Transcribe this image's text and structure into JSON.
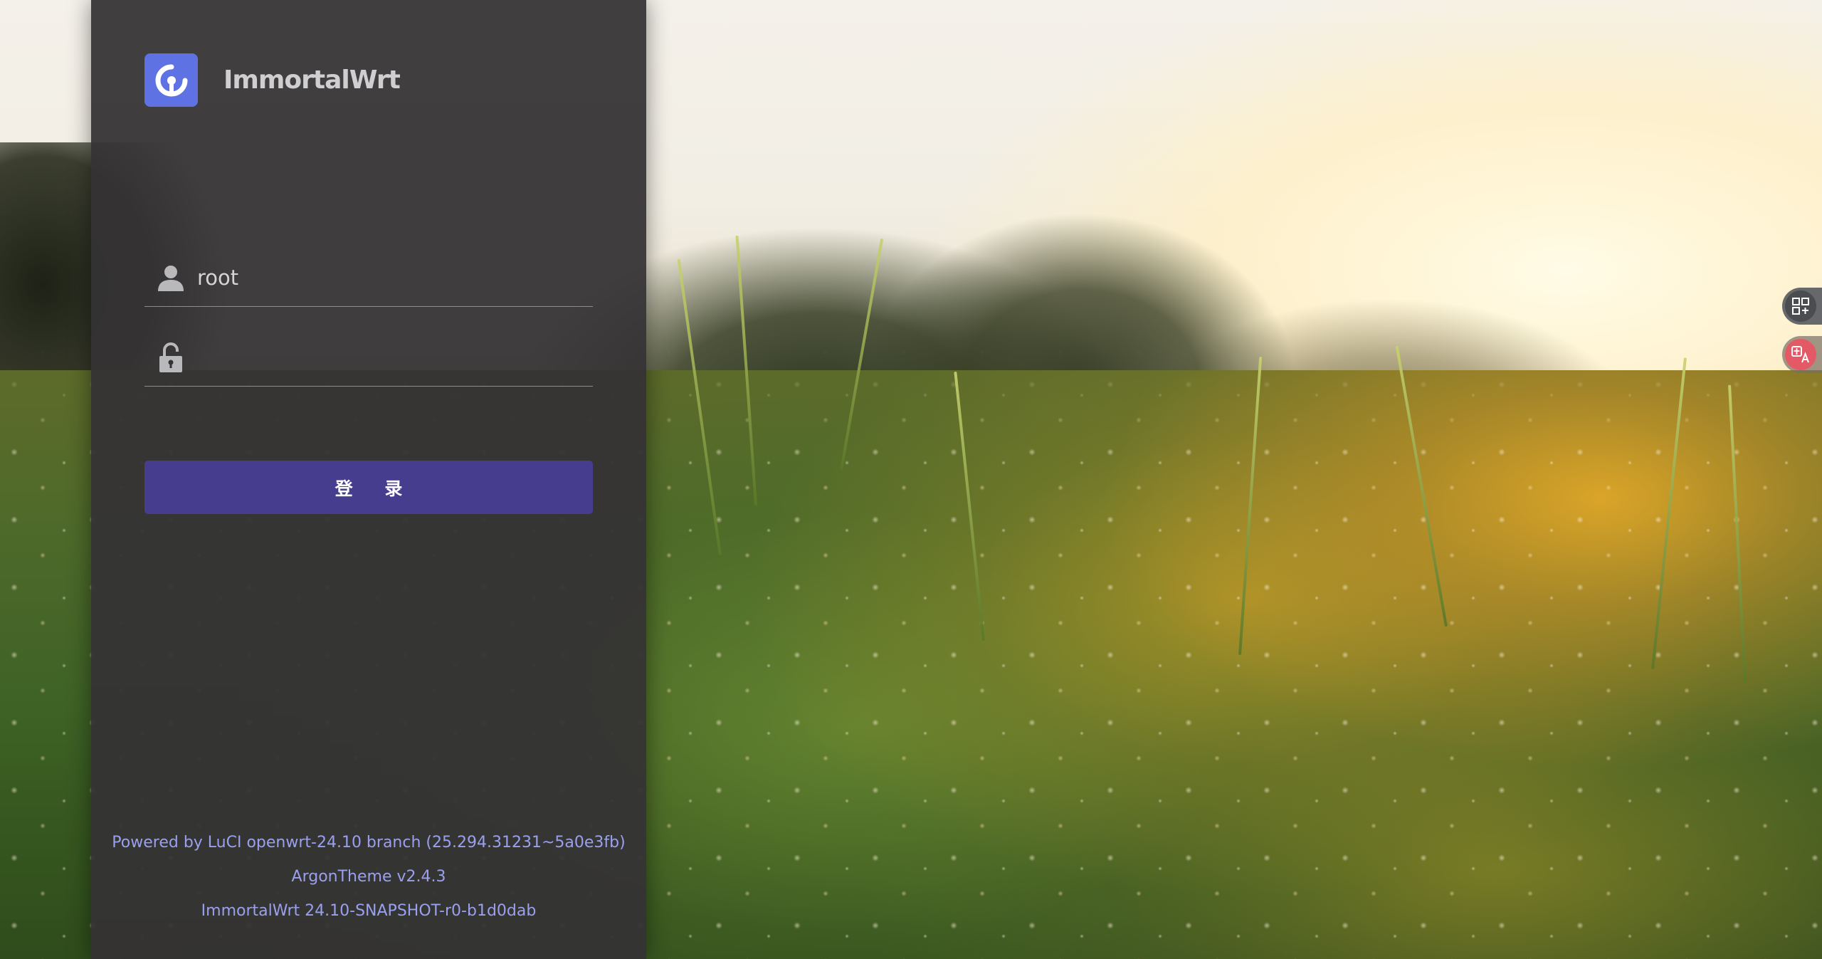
{
  "brand": {
    "name": "ImmortalWrt",
    "logo_icon": "immortalwrt-logo-icon",
    "logo_color": "#5e72e4"
  },
  "login": {
    "username_value": "root",
    "username_icon": "user-icon",
    "password_value": "",
    "password_icon": "unlock-icon",
    "submit_label": "登 录",
    "button_color": "#473d8f"
  },
  "footer": {
    "powered_by": "Powered by LuCI openwrt-24.10 branch (25.294.31231~5a0e3fb)",
    "theme": "ArgonTheme v2.4.3",
    "firmware": "ImmortalWrt 24.10-SNAPSHOT-r0-b1d0dab",
    "text_color": "#9aa0ee"
  },
  "side_tools": [
    {
      "icon": "qr-code-icon"
    },
    {
      "icon": "translate-icon"
    }
  ]
}
